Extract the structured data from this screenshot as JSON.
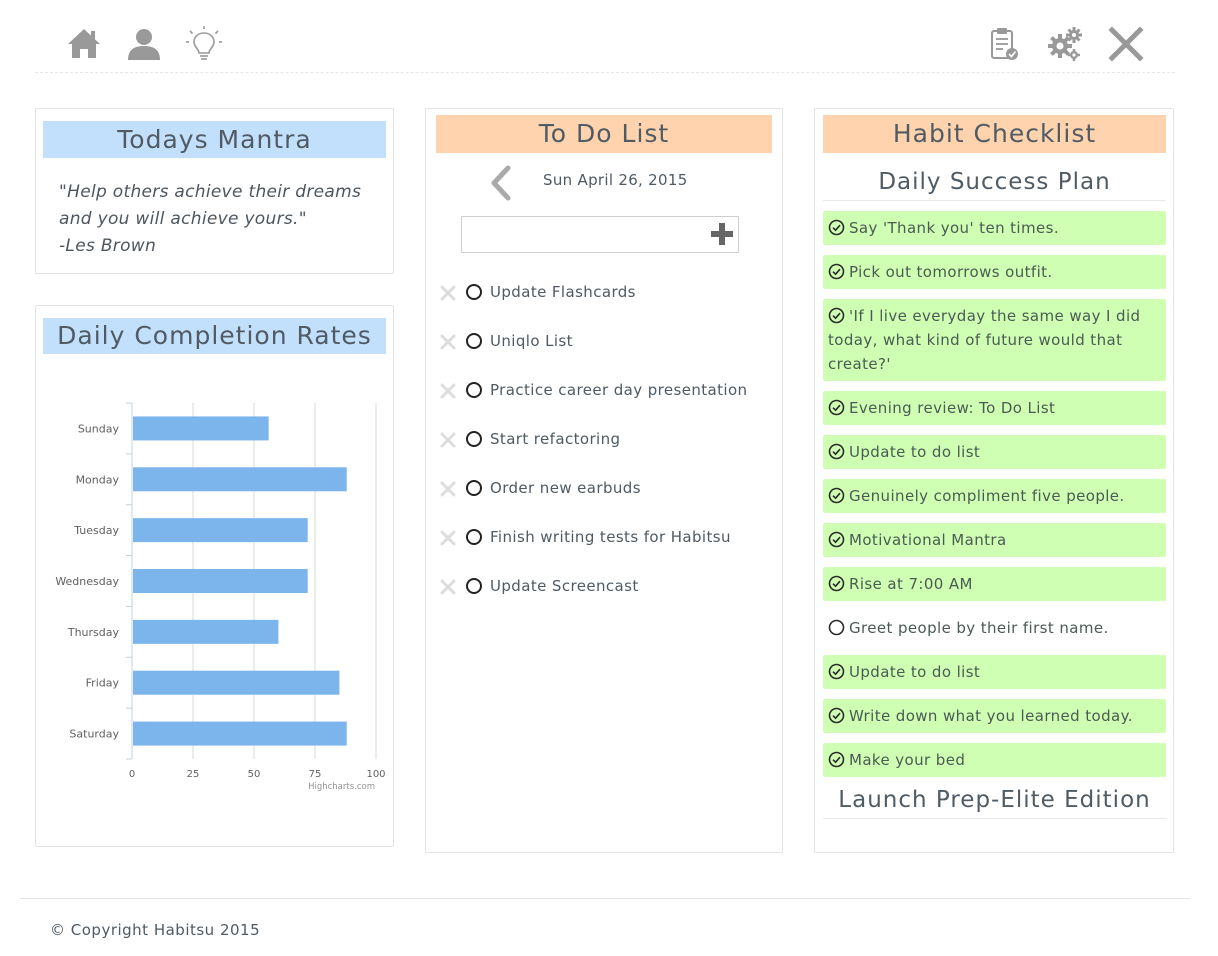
{
  "nav": {
    "left_icons": [
      "home-icon",
      "user-icon",
      "lightbulb-icon"
    ],
    "right_icons": [
      "clipboard-check-icon",
      "gears-icon",
      "close-icon"
    ]
  },
  "mantra": {
    "title": "Todays Mantra",
    "lines": [
      "\"Help others achieve their dreams",
      "and you will achieve yours.\"",
      "-Les Brown"
    ]
  },
  "completion": {
    "title": "Daily Completion Rates"
  },
  "chart_data": {
    "type": "bar",
    "orientation": "horizontal",
    "categories": [
      "Sunday",
      "Monday",
      "Tuesday",
      "Wednesday",
      "Thursday",
      "Friday",
      "Saturday"
    ],
    "values": [
      56,
      88,
      72,
      72,
      60,
      85,
      88
    ],
    "xlim": [
      0,
      100
    ],
    "ticks": [
      "0",
      "25",
      "50",
      "75",
      "100"
    ],
    "credit": "Highcharts.com",
    "grid": true,
    "bar_color": "#7cb5ec"
  },
  "todo": {
    "title": "To Do List",
    "date": "Sun April 26, 2015",
    "input_placeholder": "",
    "items": [
      "Update Flashcards",
      "Uniqlo List",
      "Practice career day presentation",
      "Start refactoring",
      "Order new earbuds",
      "Finish writing tests for Habitsu",
      "Update Screencast"
    ]
  },
  "habits": {
    "title": "Habit Checklist",
    "plan_name": "Daily Success Plan",
    "items": [
      {
        "label": "Say 'Thank you' ten times.",
        "done": true
      },
      {
        "label": "Pick out tomorrows outfit.",
        "done": true
      },
      {
        "label": "'If I live everyday the same way I did today, what kind of future would that create?'",
        "done": true
      },
      {
        "label": "Evening review: To Do List",
        "done": true
      },
      {
        "label": "Update to do list",
        "done": true
      },
      {
        "label": "Genuinely compliment five people.",
        "done": true
      },
      {
        "label": "Motivational Mantra",
        "done": true
      },
      {
        "label": "Rise at 7:00 AM",
        "done": true
      },
      {
        "label": "Greet people by their first name.",
        "done": false
      },
      {
        "label": "Update to do list",
        "done": true
      },
      {
        "label": "Write down what you learned today.",
        "done": true
      },
      {
        "label": "Make your bed",
        "done": true
      }
    ],
    "next_plan_name": "Launch Prep-Elite Edition"
  },
  "footer": {
    "copyright": "© Copyright Habitsu 2015"
  },
  "colors": {
    "blue_header": "#c2e0fb",
    "orange_header": "#fed3ad",
    "habit_done": "#cfffb3",
    "icon_gray": "#999999"
  }
}
